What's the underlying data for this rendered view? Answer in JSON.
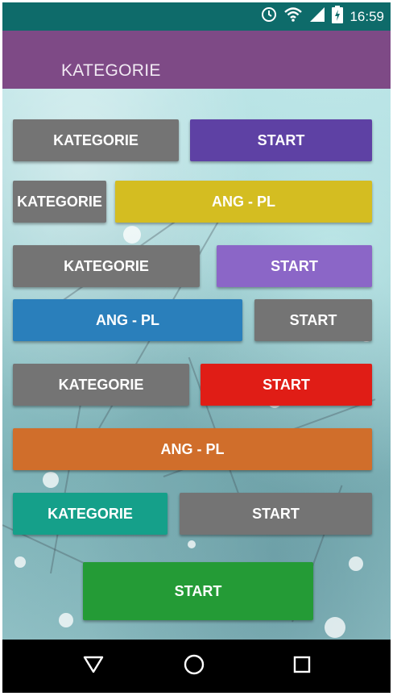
{
  "status_bar": {
    "time": "16:59",
    "icons": [
      "alarm-icon",
      "wifi-icon",
      "signal-icon",
      "battery-icon"
    ]
  },
  "app_bar": {
    "title": "KATEGORIE",
    "color": "#7e4a86"
  },
  "buttons": [
    {
      "label": "KATEGORIE",
      "color": "#747474"
    },
    {
      "label": "START",
      "color": "#5e41a4"
    },
    {
      "label": "KATEGORIE",
      "color": "#747474"
    },
    {
      "label": "ANG - PL",
      "color": "#d4bd21"
    },
    {
      "label": "KATEGORIE",
      "color": "#747474"
    },
    {
      "label": "START",
      "color": "#8b66c7"
    },
    {
      "label": "ANG - PL",
      "color": "#2a7fbb"
    },
    {
      "label": "START",
      "color": "#747474"
    },
    {
      "label": "KATEGORIE",
      "color": "#747474"
    },
    {
      "label": "START",
      "color": "#e01d16"
    },
    {
      "label": "ANG - PL",
      "color": "#d06e2b"
    },
    {
      "label": "KATEGORIE",
      "color": "#15a08a"
    },
    {
      "label": "START",
      "color": "#747474"
    },
    {
      "label": "START",
      "color": "#249b36"
    }
  ],
  "nav_bar": {
    "icons": [
      "back-icon",
      "home-icon",
      "recents-icon"
    ]
  }
}
